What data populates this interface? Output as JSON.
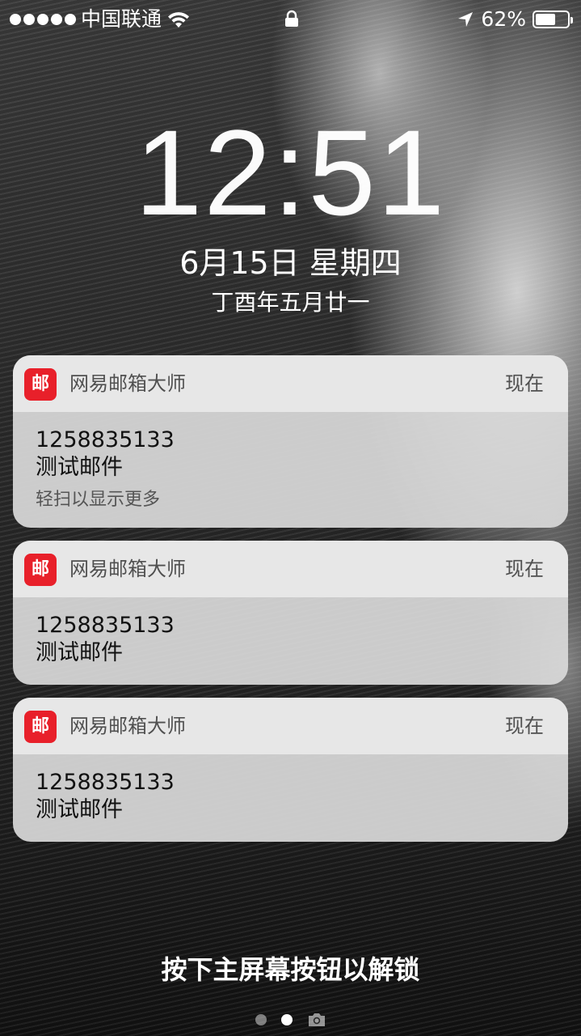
{
  "status_bar": {
    "carrier": "中国联通",
    "battery_percent_text": "62%",
    "battery_level": 0.62
  },
  "lock_screen": {
    "time": "12:51",
    "date": "6月15日 星期四",
    "lunar_date": "丁酉年五月廿一",
    "unlock_hint": "按下主屏幕按钮以解锁"
  },
  "notifications": [
    {
      "icon_text": "邮",
      "app_name": "网易邮箱大师",
      "time": "现在",
      "sender": "1258835133",
      "subject": "测试邮件",
      "hint": "轻扫以显示更多"
    },
    {
      "icon_text": "邮",
      "app_name": "网易邮箱大师",
      "time": "现在",
      "sender": "1258835133",
      "subject": "测试邮件"
    },
    {
      "icon_text": "邮",
      "app_name": "网易邮箱大师",
      "time": "现在",
      "sender": "1258835133",
      "subject": "测试邮件"
    }
  ],
  "colors": {
    "app_icon": "#e8202a"
  },
  "icons": [
    "signal-dots-icon",
    "wifi-icon",
    "lock-icon",
    "location-arrow-icon",
    "battery-icon",
    "camera-icon"
  ]
}
